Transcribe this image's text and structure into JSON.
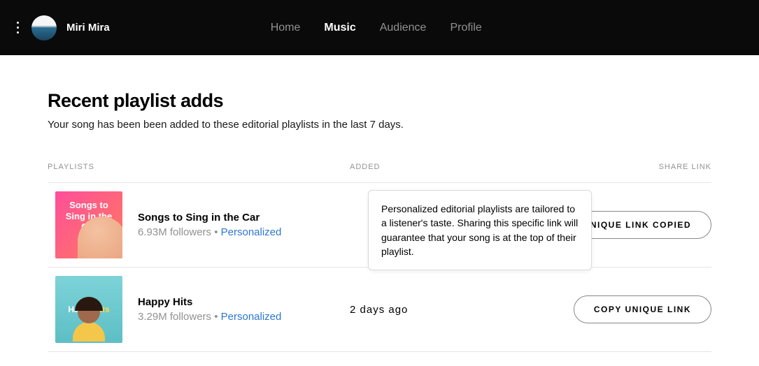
{
  "header": {
    "username": "Miri Mira",
    "nav": {
      "home": "Home",
      "music": "Music",
      "audience": "Audience",
      "profile": "Profile"
    }
  },
  "page": {
    "title": "Recent playlist adds",
    "subtitle": "Your song has been been added to these editorial playlists in the last 7 days."
  },
  "columns": {
    "playlists": "PLAYLISTS",
    "added": "ADDED",
    "share": "SHARE LINK"
  },
  "tooltip": "Personalized editorial playlists are tailored to a listener's taste. Sharing this specific link will guarantee that your song is at the top of their playlist.",
  "rows": [
    {
      "cover_label": "Songs to Sing in the Car",
      "name": "Songs to Sing in the Car",
      "followers": "6.93M followers",
      "separator": " • ",
      "tag": "Personalized",
      "added": "",
      "button": "UNIQUE LINK COPIED"
    },
    {
      "cover_label_html": "Happy Hits",
      "name": "Happy Hits",
      "followers": "3.29M followers",
      "separator": " • ",
      "tag": "Personalized",
      "added": "2  days  ago",
      "button": "COPY UNIQUE LINK"
    }
  ]
}
